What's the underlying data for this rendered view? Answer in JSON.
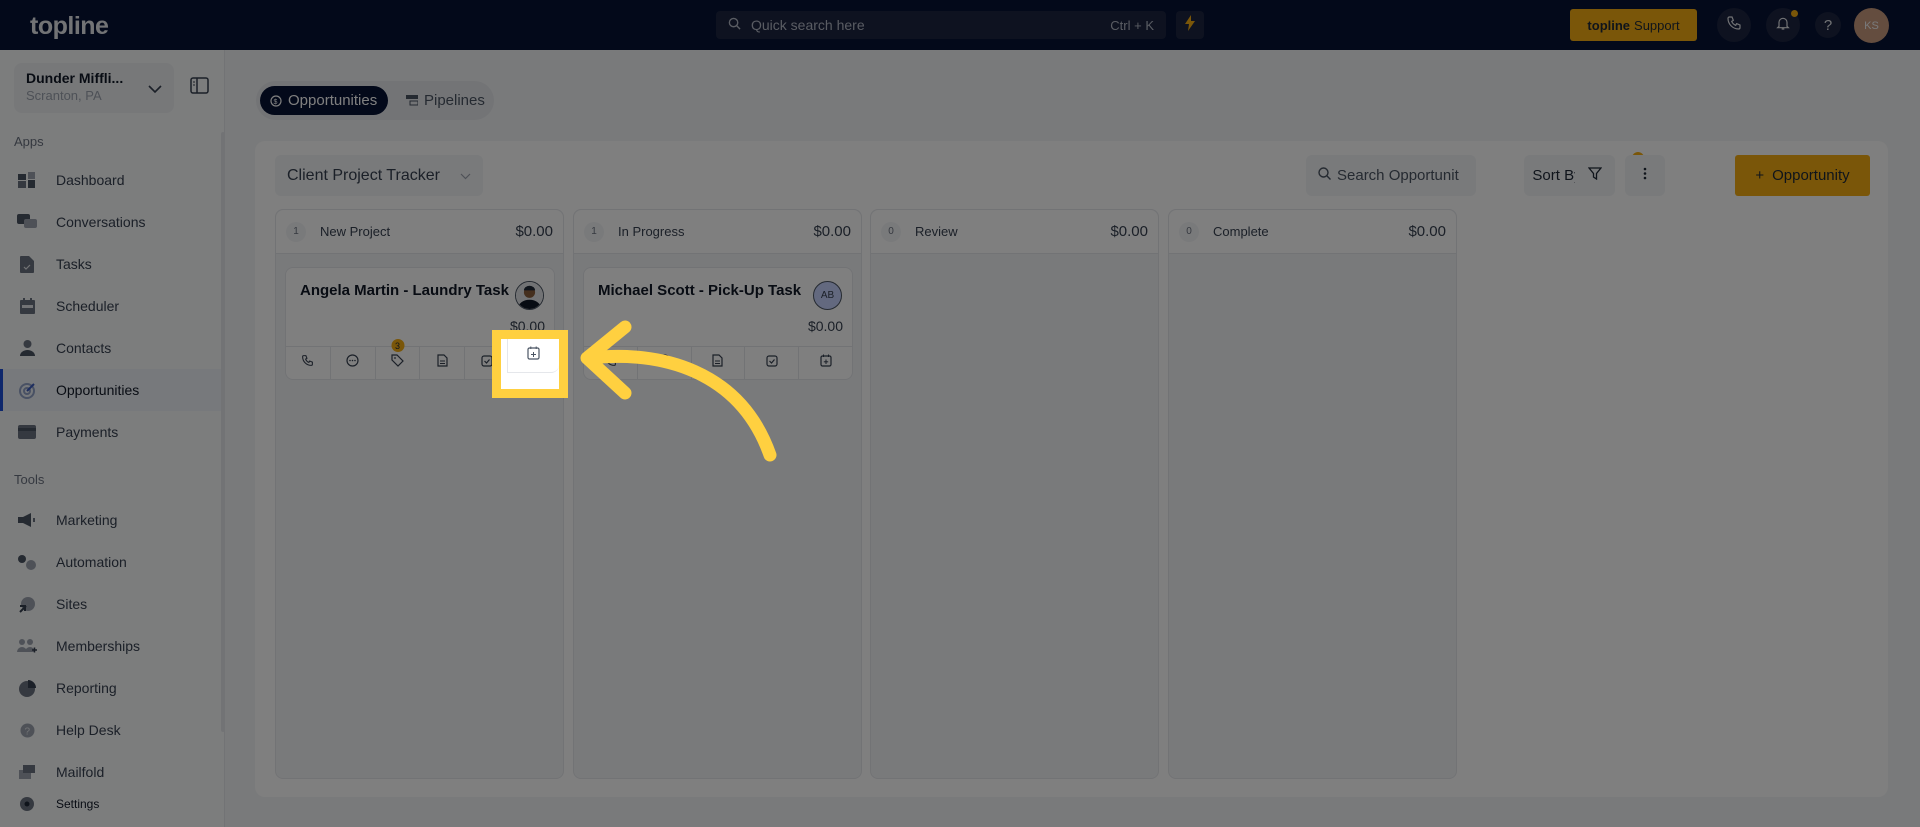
{
  "topbar": {
    "logo": "topline",
    "search_placeholder": "Quick search here",
    "search_shortcut": "Ctrl + K",
    "support_brand": "topline",
    "support_label": "Support",
    "user_initials": "KS"
  },
  "sidebar": {
    "location_name": "Dunder Miffli...",
    "location_sub": "Scranton, PA",
    "apps_heading": "Apps",
    "tools_heading": "Tools",
    "apps": [
      {
        "label": "Dashboard",
        "icon": "dashboard-icon"
      },
      {
        "label": "Conversations",
        "icon": "chat-icon"
      },
      {
        "label": "Tasks",
        "icon": "task-icon"
      },
      {
        "label": "Scheduler",
        "icon": "calendar-icon"
      },
      {
        "label": "Contacts",
        "icon": "person-icon"
      },
      {
        "label": "Opportunities",
        "icon": "target-icon",
        "active": true
      },
      {
        "label": "Payments",
        "icon": "credit-card-icon"
      }
    ],
    "tools": [
      {
        "label": "Marketing",
        "icon": "megaphone-icon"
      },
      {
        "label": "Automation",
        "icon": "gears-icon"
      },
      {
        "label": "Sites",
        "icon": "globe-icon"
      },
      {
        "label": "Memberships",
        "icon": "users-icon"
      },
      {
        "label": "Reporting",
        "icon": "pie-chart-icon"
      },
      {
        "label": "Help Desk",
        "icon": "help-icon"
      },
      {
        "label": "Mailfold",
        "icon": "mail-icon"
      }
    ],
    "settings_label": "Settings"
  },
  "main": {
    "tabs": [
      {
        "label": "Opportunities",
        "active": true
      },
      {
        "label": "Pipelines",
        "active": false
      }
    ],
    "pipeline_selected": "Client Project Tracker",
    "search_placeholder": "Search Opportunit",
    "sort_label": "Sort By",
    "add_label": "Opportunity",
    "stages": [
      {
        "count": "1",
        "name": "New Project",
        "amount": "$0.00"
      },
      {
        "count": "1",
        "name": "In Progress",
        "amount": "$0.00"
      },
      {
        "count": "0",
        "name": "Review",
        "amount": "$0.00"
      },
      {
        "count": "0",
        "name": "Complete",
        "amount": "$0.00"
      }
    ],
    "cards": [
      {
        "title": "Angela Martin - Laundry Task",
        "amount": "$0.00",
        "avatar": "photo",
        "tag_count": "3"
      },
      {
        "title": "Michael Scott - Pick-Up Task",
        "amount": "$0.00",
        "avatar_initials": "AB"
      }
    ]
  },
  "colors": {
    "topbar_bg": "#061234",
    "accent_yellow": "#f5ad12",
    "highlight_yellow": "#ffd040",
    "active_nav": "#1d4ed8"
  }
}
